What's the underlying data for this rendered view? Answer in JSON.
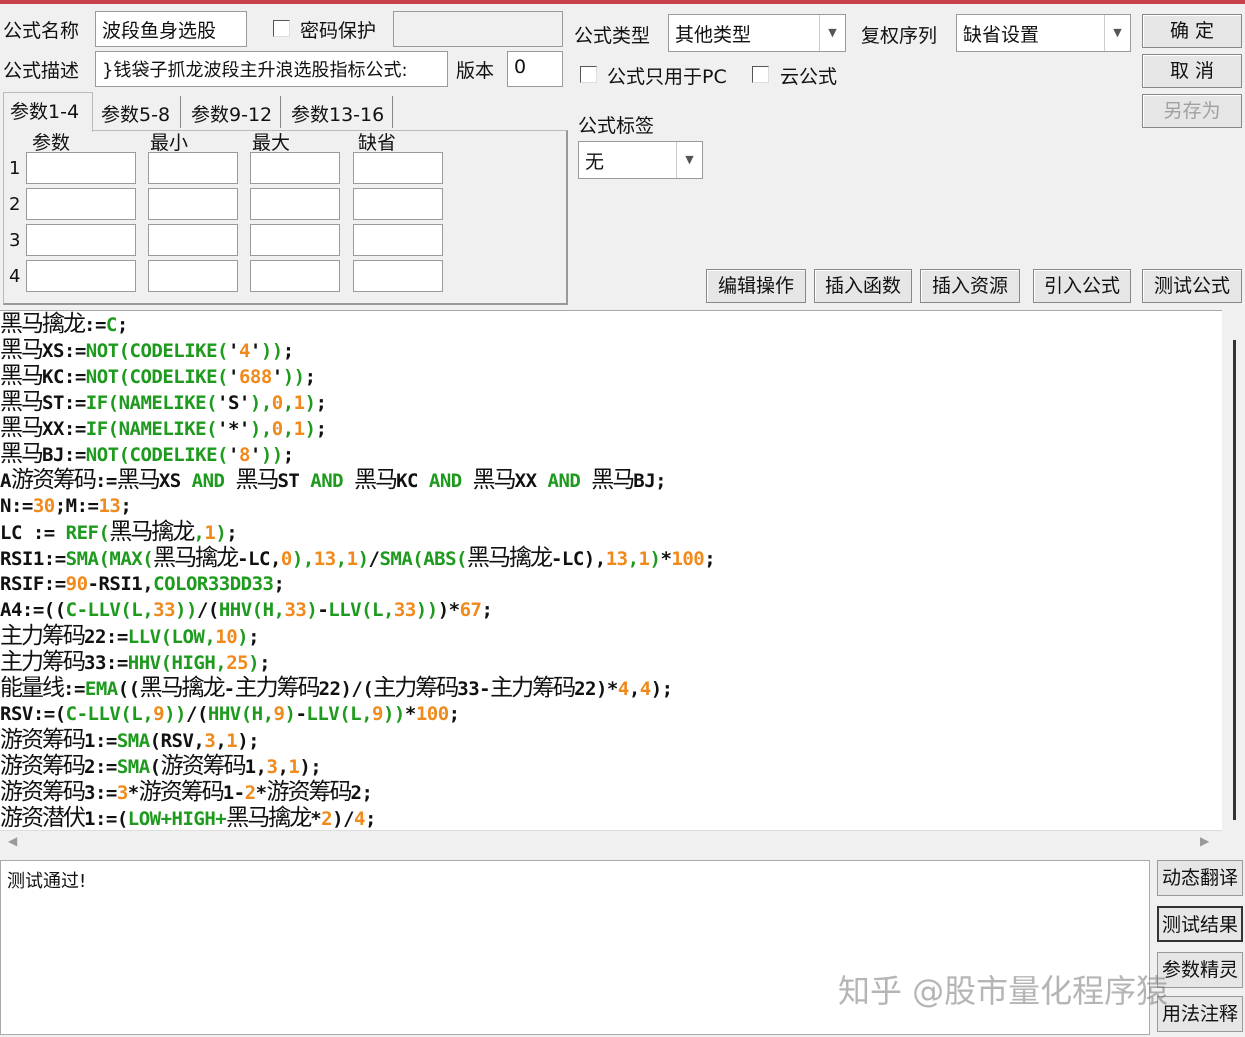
{
  "header": {
    "name_label": "公式名称",
    "name_value": "波段鱼身选股",
    "password_label": "密码保护",
    "password_value": "",
    "desc_label": "公式描述",
    "desc_value": "}钱袋子抓龙波段主升浪选股指标公式:",
    "version_label": "版本",
    "version_value": "0",
    "type_label": "公式类型",
    "type_value": "其他类型",
    "rights_label": "复权序列",
    "rights_value": "缺省设置",
    "pc_only_label": "公式只用于PC",
    "cloud_label": "云公式",
    "tag_label": "公式标签",
    "tag_value": "无",
    "ok": "确  定",
    "cancel": "取  消",
    "save_as": "另存为"
  },
  "params": {
    "tabs": [
      "参数1-4",
      "参数5-8",
      "参数9-12",
      "参数13-16"
    ],
    "columns": [
      "参数",
      "最小",
      "最大",
      "缺省"
    ],
    "rows": [
      "1",
      "2",
      "3",
      "4"
    ]
  },
  "toolbar": [
    "编辑操作",
    "插入函数",
    "插入资源",
    "引入公式",
    "测试公式"
  ],
  "code": {
    "lines": [
      [
        [
          "t",
          "黑马擒龙"
        ],
        [
          "t",
          ":="
        ],
        [
          "f",
          "C"
        ],
        [
          "t",
          ";"
        ]
      ],
      [
        [
          "t",
          "黑马"
        ],
        [
          "t",
          "XS:="
        ],
        [
          "f",
          "NOT(CODELIKE("
        ],
        [
          "t",
          "'"
        ],
        [
          "n",
          "4"
        ],
        [
          "t",
          "'"
        ],
        [
          "f",
          "))"
        ],
        [
          "t",
          ";"
        ]
      ],
      [
        [
          "t",
          "黑马"
        ],
        [
          "t",
          "KC:="
        ],
        [
          "f",
          "NOT(CODELIKE("
        ],
        [
          "t",
          "'"
        ],
        [
          "n",
          "688"
        ],
        [
          "t",
          "'"
        ],
        [
          "f",
          "))"
        ],
        [
          "t",
          ";"
        ]
      ],
      [
        [
          "t",
          "黑马"
        ],
        [
          "t",
          "ST:="
        ],
        [
          "f",
          "IF(NAMELIKE("
        ],
        [
          "t",
          "'S'"
        ],
        [
          "f",
          "),"
        ],
        [
          "n",
          "0"
        ],
        [
          "f",
          ","
        ],
        [
          "n",
          "1"
        ],
        [
          "f",
          ")"
        ],
        [
          "t",
          ";"
        ]
      ],
      [
        [
          "t",
          "黑马"
        ],
        [
          "t",
          "XX:="
        ],
        [
          "f",
          "IF(NAMELIKE("
        ],
        [
          "t",
          "'*'"
        ],
        [
          "f",
          "),"
        ],
        [
          "n",
          "0"
        ],
        [
          "f",
          ","
        ],
        [
          "n",
          "1"
        ],
        [
          "f",
          ")"
        ],
        [
          "t",
          ";"
        ]
      ],
      [
        [
          "t",
          "黑马"
        ],
        [
          "t",
          "BJ:="
        ],
        [
          "f",
          "NOT(CODELIKE("
        ],
        [
          "t",
          "'"
        ],
        [
          "n",
          "8"
        ],
        [
          "t",
          "'"
        ],
        [
          "f",
          "))"
        ],
        [
          "t",
          ";"
        ]
      ],
      [
        [
          "t",
          "A"
        ],
        [
          "t",
          "游资筹码"
        ],
        [
          "t",
          ":="
        ],
        [
          "t",
          "黑马"
        ],
        [
          "t",
          "XS "
        ],
        [
          "f",
          "AND"
        ],
        [
          "t",
          " "
        ],
        [
          "t",
          "黑马"
        ],
        [
          "t",
          "ST "
        ],
        [
          "f",
          "AND"
        ],
        [
          "t",
          " "
        ],
        [
          "t",
          "黑马"
        ],
        [
          "t",
          "KC "
        ],
        [
          "f",
          "AND"
        ],
        [
          "t",
          " "
        ],
        [
          "t",
          "黑马"
        ],
        [
          "t",
          "XX "
        ],
        [
          "f",
          "AND"
        ],
        [
          "t",
          " "
        ],
        [
          "t",
          "黑马"
        ],
        [
          "t",
          "BJ;"
        ]
      ],
      [
        [
          "t",
          "N:="
        ],
        [
          "n",
          "30"
        ],
        [
          "t",
          ";M:="
        ],
        [
          "n",
          "13"
        ],
        [
          "t",
          ";"
        ]
      ],
      [
        [
          "t",
          "LC := "
        ],
        [
          "f",
          "REF("
        ],
        [
          "t",
          "黑马擒龙"
        ],
        [
          "f",
          ","
        ],
        [
          "n",
          "1"
        ],
        [
          "f",
          ")"
        ],
        [
          "t",
          ";"
        ]
      ],
      [
        [
          "t",
          "RSI1:="
        ],
        [
          "f",
          "SMA(MAX("
        ],
        [
          "t",
          "黑马擒龙"
        ],
        [
          "t",
          "-LC,"
        ],
        [
          "n",
          "0"
        ],
        [
          "f",
          "),"
        ],
        [
          "n",
          "13"
        ],
        [
          "f",
          ","
        ],
        [
          "n",
          "1"
        ],
        [
          "f",
          ")"
        ],
        [
          "t",
          "/"
        ],
        [
          "f",
          "SMA(ABS("
        ],
        [
          "t",
          "黑马擒龙"
        ],
        [
          "t",
          "-LC),"
        ],
        [
          "n",
          "13"
        ],
        [
          "f",
          ","
        ],
        [
          "n",
          "1"
        ],
        [
          "f",
          ")"
        ],
        [
          "t",
          "*"
        ],
        [
          "n",
          "100"
        ],
        [
          "t",
          ";"
        ]
      ],
      [
        [
          "t",
          "RSIF:="
        ],
        [
          "n",
          "90"
        ],
        [
          "t",
          "-RSI1,"
        ],
        [
          "f",
          "COLOR33DD33"
        ],
        [
          "t",
          ";"
        ]
      ],
      [
        [
          "t",
          "A4:=(("
        ],
        [
          "f",
          "C-LLV(L,"
        ],
        [
          "n",
          "33"
        ],
        [
          "f",
          "))"
        ],
        [
          "t",
          "/("
        ],
        [
          "f",
          "HHV(H,"
        ],
        [
          "n",
          "33"
        ],
        [
          "f",
          ")"
        ],
        [
          "t",
          "-"
        ],
        [
          "f",
          "LLV(L,"
        ],
        [
          "n",
          "33"
        ],
        [
          "f",
          "))"
        ],
        [
          "t",
          ")*"
        ],
        [
          "n",
          "67"
        ],
        [
          "t",
          ";"
        ]
      ],
      [
        [
          "t",
          "主力筹码"
        ],
        [
          "t",
          "22:="
        ],
        [
          "f",
          "LLV(LOW,"
        ],
        [
          "n",
          "10"
        ],
        [
          "f",
          ")"
        ],
        [
          "t",
          ";"
        ]
      ],
      [
        [
          "t",
          "主力筹码"
        ],
        [
          "t",
          "33:="
        ],
        [
          "f",
          "HHV(HIGH,"
        ],
        [
          "n",
          "25"
        ],
        [
          "f",
          ")"
        ],
        [
          "t",
          ";"
        ]
      ],
      [
        [
          "t",
          "能量线"
        ],
        [
          "t",
          ":="
        ],
        [
          "f",
          "EMA"
        ],
        [
          "t",
          "(("
        ],
        [
          "t",
          "黑马擒龙-主力筹码"
        ],
        [
          "t",
          "22)/("
        ],
        [
          "t",
          "主力筹码"
        ],
        [
          "t",
          "33-"
        ],
        [
          "t",
          "主力筹码"
        ],
        [
          "t",
          "22)*"
        ],
        [
          "n",
          "4"
        ],
        [
          "t",
          ","
        ],
        [
          "n",
          "4"
        ],
        [
          "t",
          ");"
        ]
      ],
      [
        [
          "t",
          "RSV:=("
        ],
        [
          "f",
          "C-LLV(L,"
        ],
        [
          "n",
          "9"
        ],
        [
          "f",
          "))"
        ],
        [
          "t",
          "/("
        ],
        [
          "f",
          "HHV(H,"
        ],
        [
          "n",
          "9"
        ],
        [
          "f",
          ")"
        ],
        [
          "t",
          "-"
        ],
        [
          "f",
          "LLV(L,"
        ],
        [
          "n",
          "9"
        ],
        [
          "f",
          "))"
        ],
        [
          "t",
          "*"
        ],
        [
          "n",
          "100"
        ],
        [
          "t",
          ";"
        ]
      ],
      [
        [
          "t",
          "游资筹码"
        ],
        [
          "t",
          "1:="
        ],
        [
          "f",
          "SMA"
        ],
        [
          "t",
          "(RSV,"
        ],
        [
          "n",
          "3"
        ],
        [
          "t",
          ","
        ],
        [
          "n",
          "1"
        ],
        [
          "t",
          ");"
        ]
      ],
      [
        [
          "t",
          "游资筹码"
        ],
        [
          "t",
          "2:="
        ],
        [
          "f",
          "SMA"
        ],
        [
          "t",
          "("
        ],
        [
          "t",
          "游资筹码"
        ],
        [
          "t",
          "1,"
        ],
        [
          "n",
          "3"
        ],
        [
          "t",
          ","
        ],
        [
          "n",
          "1"
        ],
        [
          "t",
          ");"
        ]
      ],
      [
        [
          "t",
          "游资筹码"
        ],
        [
          "t",
          "3:="
        ],
        [
          "n",
          "3"
        ],
        [
          "t",
          "*"
        ],
        [
          "t",
          "游资筹码"
        ],
        [
          "t",
          "1-"
        ],
        [
          "n",
          "2"
        ],
        [
          "t",
          "*"
        ],
        [
          "t",
          "游资筹码"
        ],
        [
          "t",
          "2;"
        ]
      ],
      [
        [
          "t",
          "游资潜伏"
        ],
        [
          "t",
          "1:=("
        ],
        [
          "f",
          "LOW+HIGH+"
        ],
        [
          "t",
          "黑马擒龙"
        ],
        [
          "t",
          "*"
        ],
        [
          "n",
          "2"
        ],
        [
          "t",
          ")/"
        ],
        [
          "n",
          "4"
        ],
        [
          "t",
          ";"
        ]
      ]
    ]
  },
  "output": {
    "text": "测试通过!"
  },
  "side_buttons": [
    "动态翻译",
    "测试结果",
    "参数精灵",
    "用法注释"
  ],
  "watermark": "知乎 @股市量化程序猿"
}
